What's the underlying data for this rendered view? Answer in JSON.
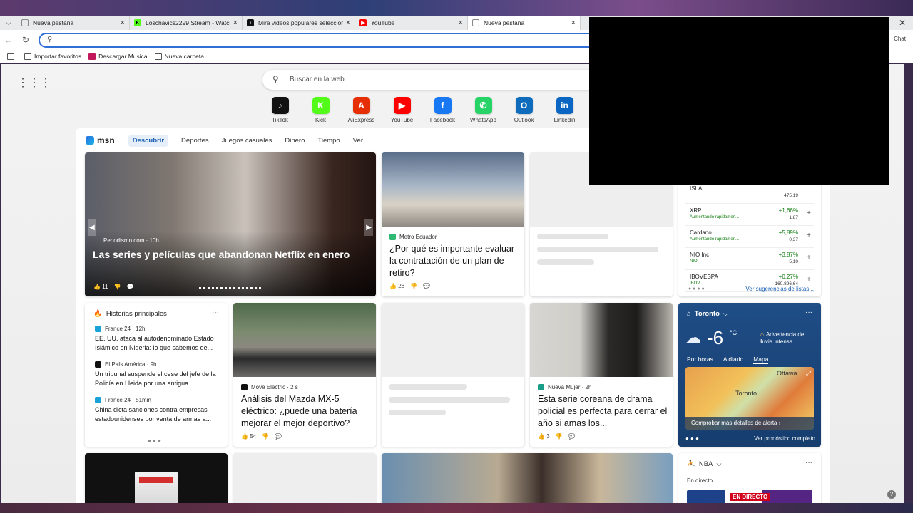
{
  "tabs": [
    {
      "title": "Nueva pestaña",
      "active": false
    },
    {
      "title": "Loschavics2299 Stream - Watch L...",
      "active": false
    },
    {
      "title": "Mira videos populares seleccione...",
      "active": false
    },
    {
      "title": "YouTube",
      "active": false
    },
    {
      "title": "Nueva pestaña",
      "active": true
    }
  ],
  "toolbar": {
    "chat_label": "Chat"
  },
  "favorites": [
    "Importar favoritos",
    "Descargar Musica",
    "Nueva carpeta"
  ],
  "search": {
    "placeholder": "Buscar en la web"
  },
  "shortcuts": [
    {
      "label": "TikTok",
      "icon": "tiktok-icon",
      "color": "#111111",
      "glyph": "♪"
    },
    {
      "label": "Kick",
      "icon": "kick-icon",
      "color": "#53fc18",
      "glyph": "K"
    },
    {
      "label": "AliExpress",
      "icon": "aliexpress-icon",
      "color": "#e62e04",
      "glyph": "A"
    },
    {
      "label": "YouTube",
      "icon": "youtube-icon",
      "color": "#ff0000",
      "glyph": "▶"
    },
    {
      "label": "Facebook",
      "icon": "facebook-icon",
      "color": "#1877f2",
      "glyph": "f"
    },
    {
      "label": "WhatsApp",
      "icon": "whatsapp-icon",
      "color": "#25d366",
      "glyph": "✆"
    },
    {
      "label": "Outlook",
      "icon": "outlook-icon",
      "color": "#0f6cbd",
      "glyph": "O"
    },
    {
      "label": "Linkedin",
      "icon": "linkedin-icon",
      "color": "#0a66c2",
      "glyph": "in"
    }
  ],
  "feed_nav": {
    "brand": "msn",
    "items": [
      "Descubrir",
      "Deportes",
      "Juegos casuales",
      "Dinero",
      "Tiempo",
      "Ver"
    ]
  },
  "hero": {
    "source": "Periodismo.com · 10h",
    "headline": "Las series y películas que abandonan Netflix en enero",
    "likes": "11"
  },
  "card_retiro": {
    "source": "Metro Ecuador",
    "headline": "¿Por qué es importante evaluar la contratación de un plan de retiro?",
    "likes": "28"
  },
  "historias": {
    "title": "Historias principales",
    "items": [
      {
        "source": "France 24 · 12h",
        "text": "EE. UU. ataca al autodenominado Estado Islámico en Nigeria: lo que sabemos de..."
      },
      {
        "source": "El País América · 9h",
        "text": "Un tribunal suspende el cese del jefe de la Policía en Lleida por una antigua..."
      },
      {
        "source": "France 24 · 51min",
        "text": "China dicta sanciones contra empresas estadounidenses por venta de armas a..."
      }
    ]
  },
  "card_mazda": {
    "source": "Move Electric · 2 s",
    "headline": "Análisis del Mazda MX-5 eléctrico: ¿puede una batería mejorar el mejor deportivo?",
    "likes": "54"
  },
  "card_serie": {
    "source": "Nueva Mujer · 2h",
    "headline": "Esta serie coreana de drama policial es perfecta para cerrar el año si amas los...",
    "likes": "3"
  },
  "markets": {
    "rows": [
      {
        "name": "ISLA",
        "sub": "",
        "change": "",
        "price": "475,19"
      },
      {
        "name": "XRP",
        "sub": "Aumentando rápidamen...",
        "change": "+1,66%",
        "price": "1,87"
      },
      {
        "name": "Cardano",
        "sub": "Aumentando rápidamen...",
        "change": "+5,89%",
        "price": "0,37"
      },
      {
        "name": "NIO Inc",
        "sub": "NIO",
        "change": "+3,87%",
        "price": "5,10"
      },
      {
        "name": "IBOVESPA",
        "sub": "IBOV",
        "change": "+0,27%",
        "price": "160.896,64"
      }
    ],
    "link": "Ver sugerencias de listas..."
  },
  "weather": {
    "city": "Toronto",
    "temp": "-6",
    "unit": "°C",
    "alert": "Advertencia de lluvia intensa",
    "tabs": [
      "Por horas",
      "A diario",
      "Mapa"
    ],
    "map_cta": "Comprobar más detalles de alerta",
    "forecast_link": "Ver pronóstico completo",
    "map_labels": [
      "Ottawa",
      "Toronto"
    ]
  },
  "nba": {
    "title": "NBA",
    "live": "En directo",
    "badge": "EN DIRECTO"
  },
  "colors": {
    "accent": "#2f6fd6",
    "brand_msn": "#1a5fb4",
    "positive": "#107c10",
    "live_red": "#d0021b"
  }
}
